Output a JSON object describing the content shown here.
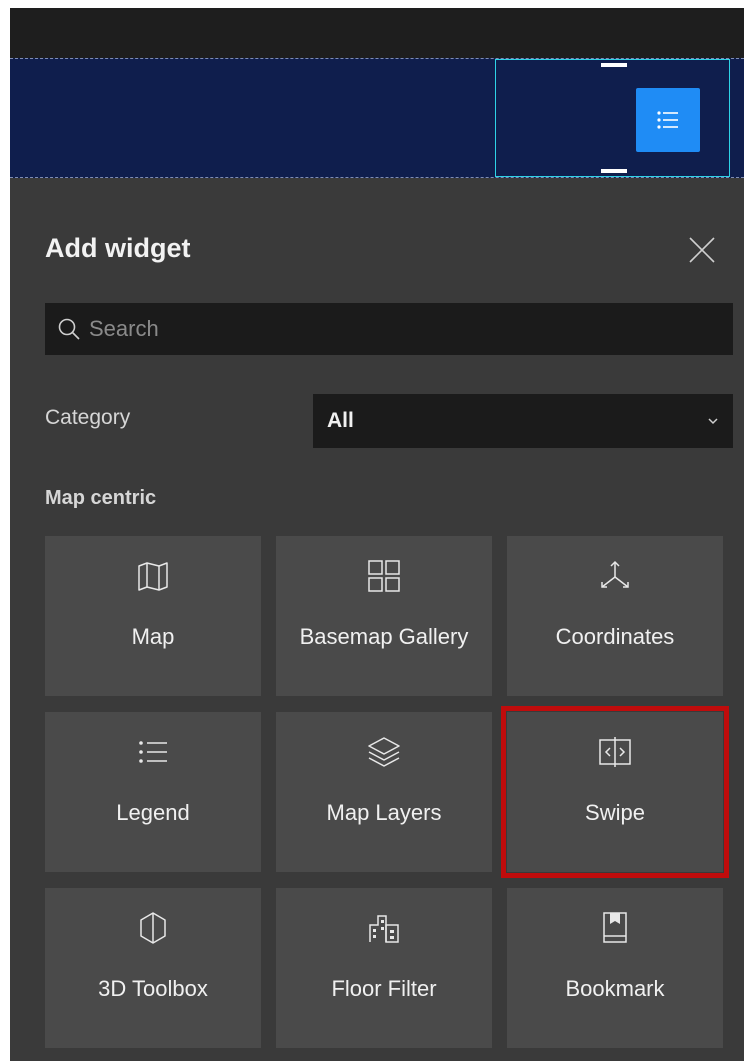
{
  "panel": {
    "title": "Add widget",
    "search_placeholder": "Search",
    "category_label": "Category",
    "category_value": "All",
    "section_label": "Map centric"
  },
  "widgets": [
    {
      "label": "Map",
      "icon": "map-icon"
    },
    {
      "label": "Basemap Gallery",
      "icon": "basemap-gallery-icon"
    },
    {
      "label": "Coordinates",
      "icon": "coordinates-icon"
    },
    {
      "label": "Legend",
      "icon": "legend-icon"
    },
    {
      "label": "Map Layers",
      "icon": "layers-icon"
    },
    {
      "label": "Swipe",
      "icon": "swipe-icon",
      "highlighted": true
    },
    {
      "label": "3D Toolbox",
      "icon": "3d-toolbox-icon"
    },
    {
      "label": "Floor Filter",
      "icon": "floor-filter-icon"
    },
    {
      "label": "Bookmark",
      "icon": "bookmark-icon"
    }
  ],
  "colors": {
    "header_band": "#0f1e4d",
    "accent_button": "#1f8cf5",
    "selection_outline": "#2ed3e6",
    "highlight_outline": "#c00c0c",
    "panel_bg": "#3a3a3a",
    "tile_bg": "#4a4a4a"
  }
}
